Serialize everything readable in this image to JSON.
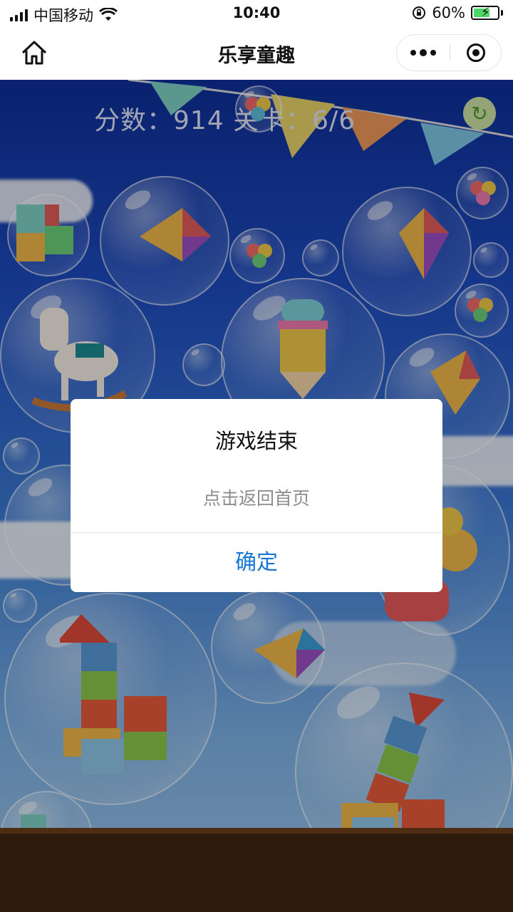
{
  "status_bar": {
    "carrier": "中国移动",
    "time": "10:40",
    "battery_percent": "60%",
    "battery_level": 0.6
  },
  "nav": {
    "title": "乐享童趣",
    "icons": [
      "home-icon",
      "more-icon",
      "close-icon"
    ]
  },
  "game": {
    "score_text": "分数：914   关卡：6/6",
    "refresh_icon": "refresh-icon"
  },
  "modal": {
    "title": "游戏结束",
    "content": "点击返回首页",
    "confirm_label": "确定",
    "confirm_color": "#1677d6"
  }
}
